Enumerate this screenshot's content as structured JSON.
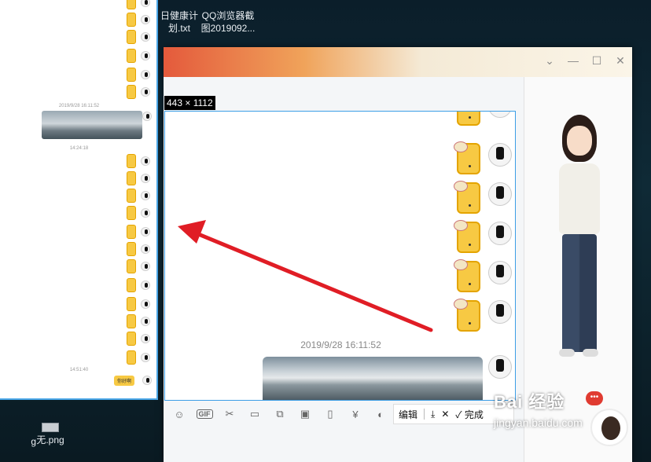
{
  "desktop": {
    "icons": [
      {
        "label_line1": "日健康计",
        "label_line2": "划.txt"
      },
      {
        "label_line1": "QQ浏览器截",
        "label_line2": "图2019092..."
      },
      {
        "label_line1": "无.png",
        "label_line2": ""
      },
      {
        "label_line1": "g",
        "label_line2": ""
      }
    ]
  },
  "long_preview": {
    "timestamps": [
      "2019/9/28 16:11:52",
      "14:24:18",
      "14:51:40"
    ],
    "last_message": "你好啊"
  },
  "capture": {
    "size_label": "443 × 1112",
    "timestamp": "2019/9/28 16:11:52"
  },
  "input_toolbar": {
    "gif_label": "GIF"
  },
  "screenshot_toolbar": {
    "edit_label": "编辑",
    "done_label": "完成"
  },
  "watermark": {
    "logo": "Bai 经验",
    "url": "jingyan.baidu.com"
  },
  "colors": {
    "selection_border": "#3c9ee6",
    "arrow": "#e01d25",
    "sticker": "#f7c943"
  }
}
